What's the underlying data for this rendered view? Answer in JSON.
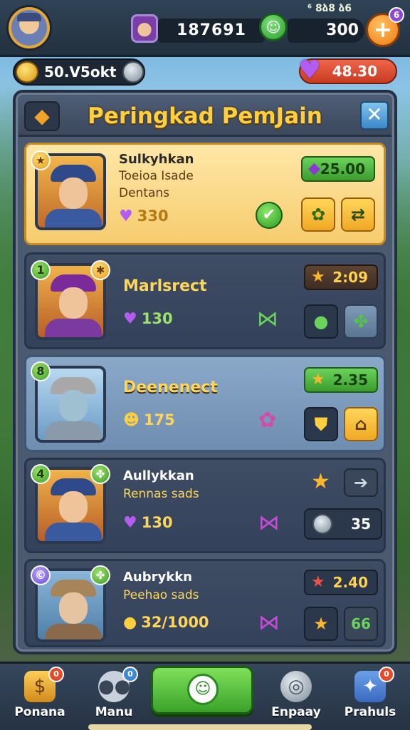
{
  "topbar": {
    "tiny_text": "⁶ 8ձ8 ձ6",
    "score": "187691",
    "chat_label": "☺",
    "gems": "300",
    "plus_label": "+",
    "plus_badge": "6"
  },
  "currency": {
    "coins": "50.V5okt",
    "hearts": "48.30"
  },
  "panel": {
    "title": "Peringkad PemJain",
    "back_label": "◆",
    "close_label": "✕"
  },
  "rows": [
    {
      "name": "Sulkyhkan",
      "sub1": "Toeioa Isade",
      "sub2": "Dentans",
      "stat": "330",
      "stat_icon": "heart-icon",
      "value": "25.00",
      "value_icon": "gem-icon",
      "rank": "★",
      "style": "gold"
    },
    {
      "name": "Marlsrect",
      "stat": "130",
      "stat_icon": "heart-icon",
      "value": "2:09",
      "value_icon": "star-icon",
      "rank": "1",
      "corner": "✱",
      "style": "dark"
    },
    {
      "name": "Deenenect",
      "stat": "175",
      "stat_icon": "smiley-icon",
      "value": "2.35",
      "value_icon": "star-icon",
      "rank": "8",
      "style": "light"
    },
    {
      "name": "Aullykkan",
      "sub1": "Rennas sads",
      "stat": "130",
      "stat_icon": "heart-icon",
      "value": "35",
      "value_icon": "coin-stack-icon",
      "rank": "4",
      "corner": "✤",
      "style": "dark"
    },
    {
      "name": "Aubrykkn",
      "sub1": "Peehao sads",
      "stat": "32/1000",
      "stat_icon": "coin-icon",
      "value": "2.40",
      "value_icon": "star-icon",
      "rank": "©",
      "corner": "✤",
      "style": "dark",
      "btn2_label": "66"
    }
  ],
  "nav": {
    "items": [
      {
        "label": "Ponana",
        "badge": "0"
      },
      {
        "label": "Manu",
        "badge": "0"
      },
      {
        "label": "Enpaay",
        "badge": ""
      },
      {
        "label": "Prahuls",
        "badge": "0"
      }
    ],
    "center_icon": "☺"
  },
  "colors": {
    "accent_gold": "#ffcf3f",
    "panel_bg": "#4c5a70",
    "green": "#3aa12a",
    "heart_purple": "#b35cf0"
  }
}
